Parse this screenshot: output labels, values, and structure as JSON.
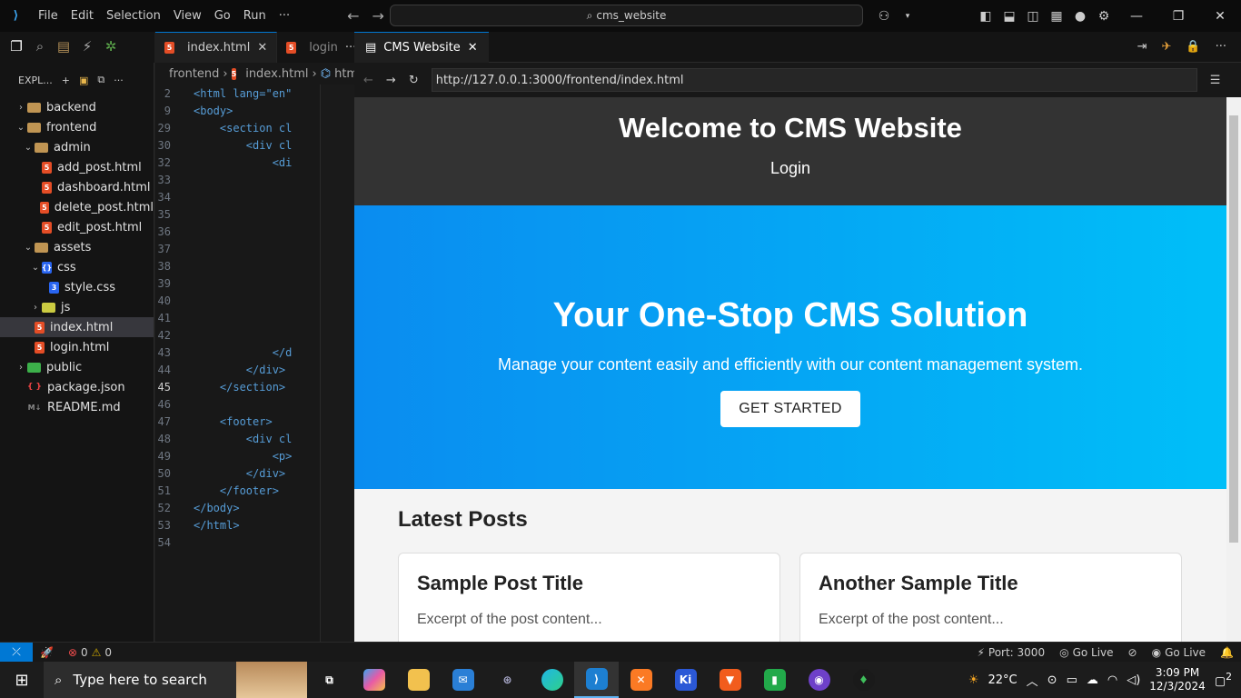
{
  "titlebar": {
    "menu": [
      "File",
      "Edit",
      "Selection",
      "View",
      "Go",
      "Run",
      "···"
    ],
    "search_text": "cms_website",
    "window_controls": [
      "minimize",
      "restore",
      "close"
    ]
  },
  "sidebar": {
    "header": "EXPL...",
    "tree": [
      {
        "label": "backend",
        "type": "folder",
        "depth": 0,
        "open": false
      },
      {
        "label": "frontend",
        "type": "folder",
        "depth": 0,
        "open": true
      },
      {
        "label": "admin",
        "type": "folder",
        "depth": 1,
        "open": true
      },
      {
        "label": "add_post.html",
        "type": "html",
        "depth": 2
      },
      {
        "label": "dashboard.html",
        "type": "html",
        "depth": 2
      },
      {
        "label": "delete_post.html",
        "type": "html",
        "depth": 2
      },
      {
        "label": "edit_post.html",
        "type": "html",
        "depth": 2
      },
      {
        "label": "assets",
        "type": "folder",
        "depth": 1,
        "open": true
      },
      {
        "label": "css",
        "type": "cssfolder",
        "depth": 2,
        "open": true
      },
      {
        "label": "style.css",
        "type": "css",
        "depth": 3
      },
      {
        "label": "js",
        "type": "jsfolder",
        "depth": 2,
        "open": false
      },
      {
        "label": "index.html",
        "type": "html",
        "depth": 1,
        "selected": true
      },
      {
        "label": "login.html",
        "type": "html",
        "depth": 1
      },
      {
        "label": "public",
        "type": "public",
        "depth": 0,
        "open": false
      },
      {
        "label": "package.json",
        "type": "json",
        "depth": 0
      },
      {
        "label": "README.md",
        "type": "md",
        "depth": 0
      }
    ]
  },
  "editor": {
    "tabs": [
      {
        "label": "index.html",
        "active": true
      },
      {
        "label": "login",
        "active": false
      }
    ],
    "breadcrumb": [
      "frontend",
      "index.html",
      "htm"
    ],
    "lines": [
      {
        "n": "2",
        "t": "<html lang=\"en\""
      },
      {
        "n": "9",
        "t": "<body>"
      },
      {
        "n": "29",
        "t": "    <section cl"
      },
      {
        "n": "30",
        "t": "        <div cl"
      },
      {
        "n": "32",
        "t": "            <di"
      },
      {
        "n": "33",
        "t": ""
      },
      {
        "n": "34",
        "t": ""
      },
      {
        "n": "35",
        "t": ""
      },
      {
        "n": "36",
        "t": ""
      },
      {
        "n": "37",
        "t": ""
      },
      {
        "n": "38",
        "t": ""
      },
      {
        "n": "39",
        "t": ""
      },
      {
        "n": "40",
        "t": ""
      },
      {
        "n": "41",
        "t": ""
      },
      {
        "n": "42",
        "t": ""
      },
      {
        "n": "43",
        "t": "            </d"
      },
      {
        "n": "44",
        "t": "        </div>"
      },
      {
        "n": "45",
        "t": "    </section>"
      },
      {
        "n": "46",
        "t": ""
      },
      {
        "n": "47",
        "t": "    <footer>"
      },
      {
        "n": "48",
        "t": "        <div cl"
      },
      {
        "n": "49",
        "t": "            <p>"
      },
      {
        "n": "50",
        "t": "        </div>"
      },
      {
        "n": "51",
        "t": "    </footer>"
      },
      {
        "n": "52",
        "t": "</body>"
      },
      {
        "n": "53",
        "t": "</html>"
      },
      {
        "n": "54",
        "t": ""
      }
    ],
    "current_line": "45"
  },
  "browser": {
    "tab_label": "CMS Website",
    "url": "http://127.0.0.1:3000/frontend/index.html",
    "page": {
      "header_title": "Welcome to CMS Website",
      "nav_login": "Login",
      "hero_title": "Your One-Stop CMS Solution",
      "hero_text": "Manage your content easily and efficiently with our content management system.",
      "hero_button": "GET STARTED",
      "posts_heading": "Latest Posts",
      "posts": [
        {
          "title": "Sample Post Title",
          "excerpt": "Excerpt of the post content..."
        },
        {
          "title": "Another Sample Title",
          "excerpt": "Excerpt of the post content..."
        }
      ]
    }
  },
  "statusbar": {
    "errors": "0",
    "warnings": "0",
    "port": "Port: 3000",
    "golive1": "Go Live",
    "golive2": "Go Live"
  },
  "taskbar": {
    "search_placeholder": "Type here to search",
    "weather": "22°C",
    "time": "3:09 PM",
    "date": "12/3/2024",
    "notifications": "2",
    "apps": [
      "task-view",
      "copilot",
      "file-explorer",
      "mail",
      "app-satellite",
      "edge",
      "vscode",
      "xampp",
      "ki",
      "brave",
      "app-green",
      "github-desktop",
      "mongodb-compass"
    ]
  },
  "colors": {
    "accent": "#0078d4",
    "hero_start": "#0a8cf0",
    "hero_end": "#00bff8",
    "site_header": "#333333"
  }
}
